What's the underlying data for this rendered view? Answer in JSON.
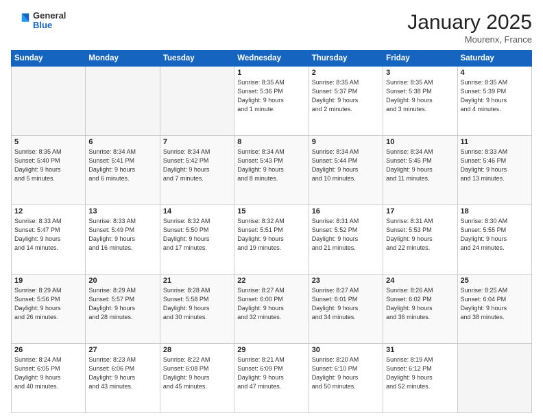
{
  "header": {
    "logo": {
      "line1": "General",
      "line2": "Blue"
    },
    "title": "January 2025",
    "location": "Mourenx, France"
  },
  "weekdays": [
    "Sunday",
    "Monday",
    "Tuesday",
    "Wednesday",
    "Thursday",
    "Friday",
    "Saturday"
  ],
  "weeks": [
    [
      {
        "day": "",
        "info": ""
      },
      {
        "day": "",
        "info": ""
      },
      {
        "day": "",
        "info": ""
      },
      {
        "day": "1",
        "info": "Sunrise: 8:35 AM\nSunset: 5:36 PM\nDaylight: 9 hours\nand 1 minute."
      },
      {
        "day": "2",
        "info": "Sunrise: 8:35 AM\nSunset: 5:37 PM\nDaylight: 9 hours\nand 2 minutes."
      },
      {
        "day": "3",
        "info": "Sunrise: 8:35 AM\nSunset: 5:38 PM\nDaylight: 9 hours\nand 3 minutes."
      },
      {
        "day": "4",
        "info": "Sunrise: 8:35 AM\nSunset: 5:39 PM\nDaylight: 9 hours\nand 4 minutes."
      }
    ],
    [
      {
        "day": "5",
        "info": "Sunrise: 8:35 AM\nSunset: 5:40 PM\nDaylight: 9 hours\nand 5 minutes."
      },
      {
        "day": "6",
        "info": "Sunrise: 8:34 AM\nSunset: 5:41 PM\nDaylight: 9 hours\nand 6 minutes."
      },
      {
        "day": "7",
        "info": "Sunrise: 8:34 AM\nSunset: 5:42 PM\nDaylight: 9 hours\nand 7 minutes."
      },
      {
        "day": "8",
        "info": "Sunrise: 8:34 AM\nSunset: 5:43 PM\nDaylight: 9 hours\nand 8 minutes."
      },
      {
        "day": "9",
        "info": "Sunrise: 8:34 AM\nSunset: 5:44 PM\nDaylight: 9 hours\nand 10 minutes."
      },
      {
        "day": "10",
        "info": "Sunrise: 8:34 AM\nSunset: 5:45 PM\nDaylight: 9 hours\nand 11 minutes."
      },
      {
        "day": "11",
        "info": "Sunrise: 8:33 AM\nSunset: 5:46 PM\nDaylight: 9 hours\nand 13 minutes."
      }
    ],
    [
      {
        "day": "12",
        "info": "Sunrise: 8:33 AM\nSunset: 5:47 PM\nDaylight: 9 hours\nand 14 minutes."
      },
      {
        "day": "13",
        "info": "Sunrise: 8:33 AM\nSunset: 5:49 PM\nDaylight: 9 hours\nand 16 minutes."
      },
      {
        "day": "14",
        "info": "Sunrise: 8:32 AM\nSunset: 5:50 PM\nDaylight: 9 hours\nand 17 minutes."
      },
      {
        "day": "15",
        "info": "Sunrise: 8:32 AM\nSunset: 5:51 PM\nDaylight: 9 hours\nand 19 minutes."
      },
      {
        "day": "16",
        "info": "Sunrise: 8:31 AM\nSunset: 5:52 PM\nDaylight: 9 hours\nand 21 minutes."
      },
      {
        "day": "17",
        "info": "Sunrise: 8:31 AM\nSunset: 5:53 PM\nDaylight: 9 hours\nand 22 minutes."
      },
      {
        "day": "18",
        "info": "Sunrise: 8:30 AM\nSunset: 5:55 PM\nDaylight: 9 hours\nand 24 minutes."
      }
    ],
    [
      {
        "day": "19",
        "info": "Sunrise: 8:29 AM\nSunset: 5:56 PM\nDaylight: 9 hours\nand 26 minutes."
      },
      {
        "day": "20",
        "info": "Sunrise: 8:29 AM\nSunset: 5:57 PM\nDaylight: 9 hours\nand 28 minutes."
      },
      {
        "day": "21",
        "info": "Sunrise: 8:28 AM\nSunset: 5:58 PM\nDaylight: 9 hours\nand 30 minutes."
      },
      {
        "day": "22",
        "info": "Sunrise: 8:27 AM\nSunset: 6:00 PM\nDaylight: 9 hours\nand 32 minutes."
      },
      {
        "day": "23",
        "info": "Sunrise: 8:27 AM\nSunset: 6:01 PM\nDaylight: 9 hours\nand 34 minutes."
      },
      {
        "day": "24",
        "info": "Sunrise: 8:26 AM\nSunset: 6:02 PM\nDaylight: 9 hours\nand 36 minutes."
      },
      {
        "day": "25",
        "info": "Sunrise: 8:25 AM\nSunset: 6:04 PM\nDaylight: 9 hours\nand 38 minutes."
      }
    ],
    [
      {
        "day": "26",
        "info": "Sunrise: 8:24 AM\nSunset: 6:05 PM\nDaylight: 9 hours\nand 40 minutes."
      },
      {
        "day": "27",
        "info": "Sunrise: 8:23 AM\nSunset: 6:06 PM\nDaylight: 9 hours\nand 43 minutes."
      },
      {
        "day": "28",
        "info": "Sunrise: 8:22 AM\nSunset: 6:08 PM\nDaylight: 9 hours\nand 45 minutes."
      },
      {
        "day": "29",
        "info": "Sunrise: 8:21 AM\nSunset: 6:09 PM\nDaylight: 9 hours\nand 47 minutes."
      },
      {
        "day": "30",
        "info": "Sunrise: 8:20 AM\nSunset: 6:10 PM\nDaylight: 9 hours\nand 50 minutes."
      },
      {
        "day": "31",
        "info": "Sunrise: 8:19 AM\nSunset: 6:12 PM\nDaylight: 9 hours\nand 52 minutes."
      },
      {
        "day": "",
        "info": ""
      }
    ]
  ]
}
